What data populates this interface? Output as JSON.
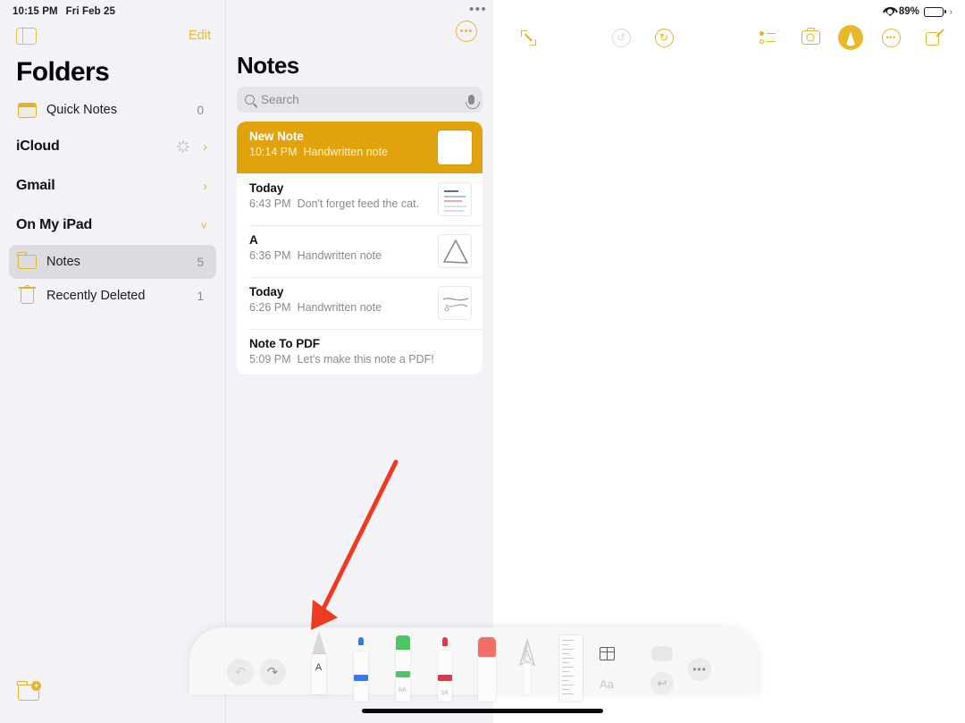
{
  "status_bar": {
    "time": "10:15 PM",
    "date": "Fri Feb 25",
    "battery_percent": "89%",
    "wifi_icon": "wifi-icon",
    "battery_icon": "battery-icon",
    "battery_level": 89
  },
  "sidebar": {
    "toggle_icon": "sidebar-toggle-icon",
    "edit_label": "Edit",
    "title": "Folders",
    "new_folder_icon": "new-folder-icon",
    "items": [
      {
        "label": "Quick Notes",
        "count": "0",
        "icon": "quick-note-icon",
        "type": "folder",
        "selected": false
      },
      {
        "label": "iCloud",
        "count": "",
        "icon": "chevron-right-icon",
        "type": "account",
        "selected": false,
        "spinner": true
      },
      {
        "label": "Gmail",
        "count": "",
        "icon": "chevron-right-icon",
        "type": "account",
        "selected": false,
        "spinner": false
      },
      {
        "label": "On My iPad",
        "count": "",
        "icon": "chevron-down-icon",
        "type": "account",
        "selected": false,
        "spinner": false
      },
      {
        "label": "Notes",
        "count": "5",
        "icon": "folder-icon",
        "type": "folder",
        "selected": true
      },
      {
        "label": "Recently Deleted",
        "count": "1",
        "icon": "trash-icon",
        "type": "folder",
        "selected": false
      }
    ]
  },
  "notelist": {
    "title": "Notes",
    "more_icon": "more-circle-icon",
    "dots_icon": "multitask-dots-icon",
    "search": {
      "placeholder": "Search",
      "value": "",
      "search_icon": "search-icon",
      "mic_icon": "microphone-icon"
    },
    "notes": [
      {
        "title": "New Note",
        "time": "10:14 PM",
        "preview": "Handwritten note",
        "selected": true,
        "thumb": "blank-thumbnail"
      },
      {
        "title": "Today",
        "time": "6:43 PM",
        "preview": "Don't forget feed the cat.",
        "selected": false,
        "thumb": "text-lines-thumbnail"
      },
      {
        "title": "A",
        "time": "6:36 PM",
        "preview": "Handwritten note",
        "selected": false,
        "thumb": "triangle-drawing-thumbnail"
      },
      {
        "title": "Today",
        "time": "6:26 PM",
        "preview": "Handwritten note",
        "selected": false,
        "thumb": "scribble-thumbnail"
      },
      {
        "title": "Note To PDF",
        "time": "5:09 PM",
        "preview": "Let's make this note a PDF!",
        "selected": false,
        "thumb": ""
      }
    ]
  },
  "editor_toolbar": {
    "buttons": [
      {
        "name": "expand-icon",
        "label": "",
        "state": "enabled"
      },
      {
        "name": "undo-icon",
        "label": "",
        "state": "disabled"
      },
      {
        "name": "redo-icon",
        "label": "",
        "state": "enabled"
      },
      {
        "name": "checklist-icon",
        "label": "",
        "state": "enabled"
      },
      {
        "name": "camera-icon",
        "label": "",
        "state": "enabled"
      },
      {
        "name": "markup-pen-icon",
        "label": "",
        "state": "active"
      },
      {
        "name": "more-icon",
        "label": "",
        "state": "enabled"
      },
      {
        "name": "compose-icon",
        "label": "",
        "state": "enabled"
      }
    ],
    "accent_color": "#e0b526",
    "active_color": "#e8b828"
  },
  "markup_toolbar": {
    "undo_label": "↶",
    "redo_label": "↷",
    "more_label": "•••",
    "aa_label": "Aa",
    "tools": [
      {
        "name": "pen-tool",
        "letter": "A",
        "mini": "",
        "color": "#4a4a4e",
        "selected": true
      },
      {
        "name": "blue-pen-tool",
        "letter": "",
        "mini": "",
        "color": "#3478f6",
        "selected": false
      },
      {
        "name": "green-highlighter",
        "letter": "",
        "mini": "bA",
        "color": "#4cc764",
        "selected": false
      },
      {
        "name": "red-marker-tool",
        "letter": "",
        "mini": "3A",
        "color": "#e0374a",
        "selected": false
      },
      {
        "name": "eraser-tool",
        "letter": "",
        "mini": "",
        "color": "#f07069",
        "selected": false
      },
      {
        "name": "lasso-tool",
        "letter": "",
        "mini": "",
        "color": "#bdbdc2",
        "selected": false
      },
      {
        "name": "ruler-tool",
        "letter": "",
        "mini": "",
        "color": "#c9c9ce",
        "selected": false
      }
    ],
    "right_buttons": [
      {
        "name": "grid-table-icon",
        "state": "enabled"
      },
      {
        "name": "color-swatch",
        "state": "enabled"
      },
      {
        "name": "text-format-icon",
        "state": "dim"
      },
      {
        "name": "shape-undo-icon",
        "state": "dim"
      },
      {
        "name": "more-options-icon",
        "state": "enabled"
      }
    ]
  },
  "annotation": {
    "arrow_color": "#ee3b20",
    "points_to": "pen-tool"
  }
}
